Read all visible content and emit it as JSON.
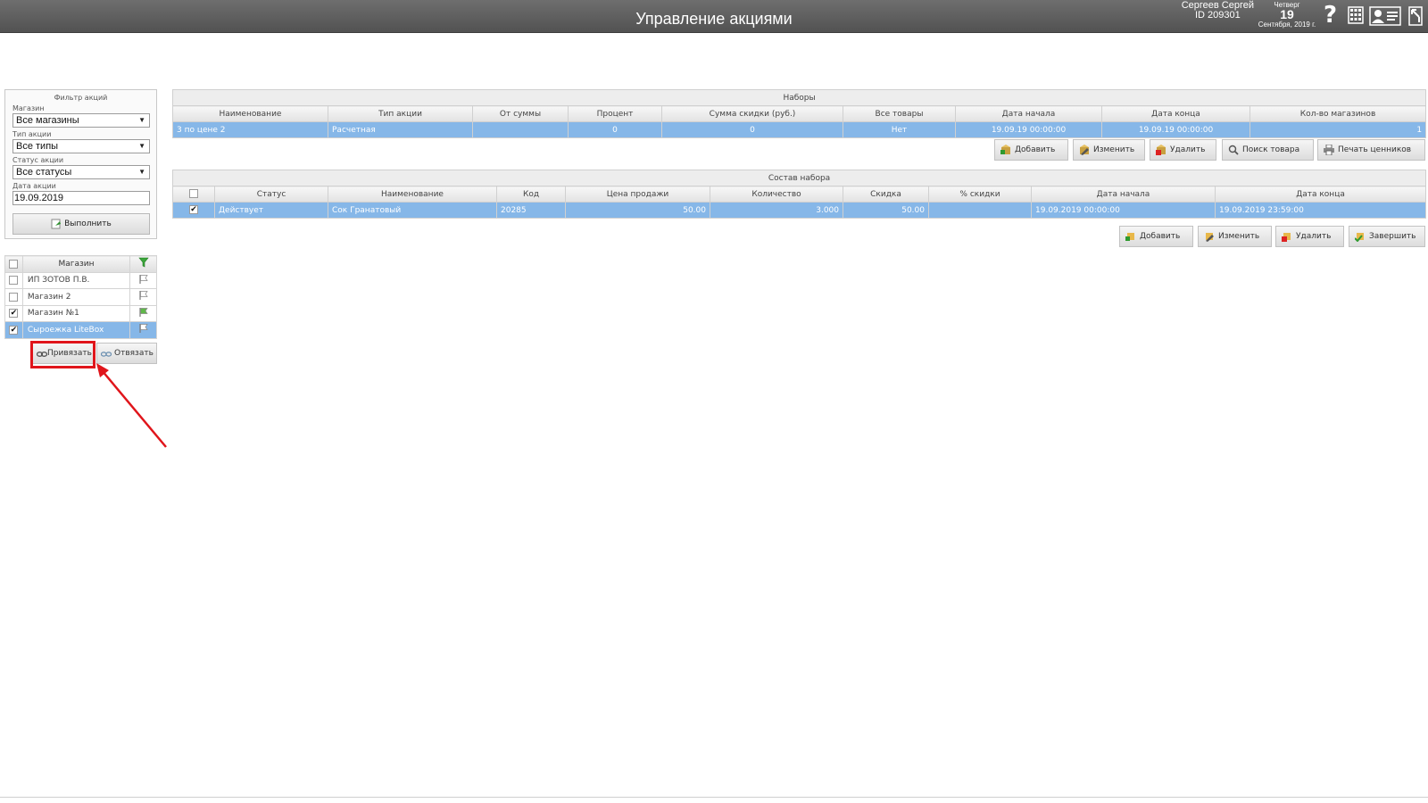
{
  "header": {
    "title": "Управление акциями",
    "user_name": "Сергеев Сергей",
    "user_id": "ID 209301",
    "weekday": "Четверг",
    "day": "19",
    "month_year": "Сентября, 2019 г.",
    "help_glyph": "?",
    "icons": [
      "help-icon",
      "grid-icon",
      "profile-icon",
      "exit-icon"
    ]
  },
  "filter": {
    "title": "Фильтр акций",
    "store_label": "Магазин",
    "store_value": "Все магазины",
    "type_label": "Тип акции",
    "type_value": "Все типы",
    "status_label": "Статус акции",
    "status_value": "Все статусы",
    "date_label": "Дата акции",
    "date_value": "19.09.2019",
    "execute_label": "Выполнить"
  },
  "stores": {
    "header": "Магазин",
    "rows": [
      {
        "name": "ИП ЗОТОВ П.В.",
        "checked": false,
        "selected": false
      },
      {
        "name": "Магазин 2",
        "checked": false,
        "selected": false
      },
      {
        "name": "Магазин №1",
        "checked": true,
        "selected": false
      },
      {
        "name": "Сыроежка LiteBox",
        "checked": true,
        "selected": true
      }
    ],
    "bind_label": "Привязать",
    "unbind_label": "Отвязать"
  },
  "sets": {
    "caption": "Наборы",
    "columns": [
      "Наименование",
      "Тип акции",
      "От суммы",
      "Процент",
      "Сумма скидки (руб.)",
      "Все товары",
      "Дата начала",
      "Дата конца",
      "Кол-во магазинов"
    ],
    "rows": [
      [
        "3 по цене 2",
        "Расчетная",
        "",
        "0",
        "0",
        "Нет",
        "19.09.19 00:00:00",
        "19.09.19 00:00:00",
        "1"
      ]
    ],
    "buttons": {
      "add": "Добавить",
      "edit": "Изменить",
      "delete": "Удалить",
      "search": "Поиск товара",
      "print": "Печать ценников"
    }
  },
  "composition": {
    "caption": "Состав набора",
    "columns": [
      "Статус",
      "Наименование",
      "Код",
      "Цена продажи",
      "Количество",
      "Скидка",
      "% скидки",
      "Дата начала",
      "Дата конца"
    ],
    "rows": [
      [
        "Действует",
        "Сок Гранатовый",
        "20285",
        "50.00",
        "3.000",
        "50.00",
        "",
        "19.09.2019 00:00:00",
        "19.09.2019 23:59:00"
      ]
    ],
    "buttons": {
      "add": "Добавить",
      "edit": "Изменить",
      "delete": "Удалить",
      "finish": "Завершить"
    }
  },
  "colors": {
    "selection": "#86b7e8",
    "header_bar": "#5e5e5e",
    "highlight": "#e0151b"
  }
}
